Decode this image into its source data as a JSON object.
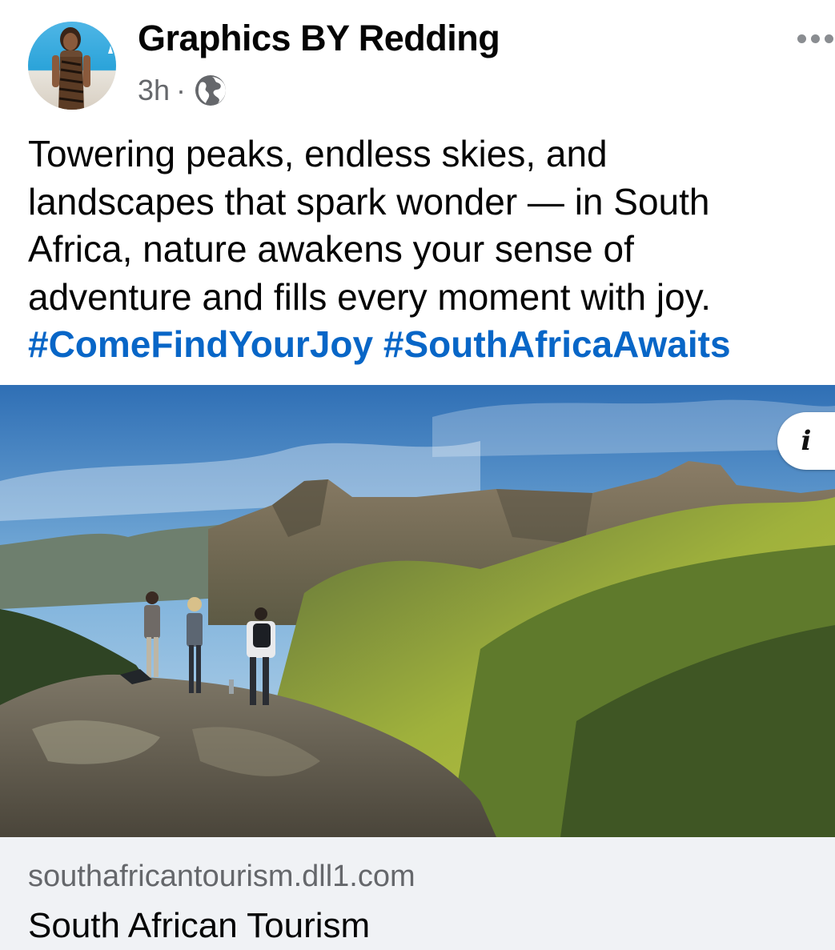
{
  "post": {
    "author": "Graphics BY Redding",
    "timestamp": "3h",
    "separator": "·",
    "audience_icon": "globe-icon",
    "text_lines": [
      "Towering peaks, endless skies, and",
      "landscapes that spark wonder — in South",
      "Africa, nature awakens your sense of",
      "adventure and fills every moment with joy."
    ],
    "hashtags": [
      "#ComeFindYourJoy",
      "#SouthAfricaAwaits"
    ]
  },
  "link_preview": {
    "info_glyph": "i",
    "domain": "southafricantourism.dll1.com",
    "title": "South African Tourism"
  },
  "colors": {
    "hashtag": "#0866c7",
    "meta_text": "#65676b",
    "footer_bg": "#f0f2f5"
  }
}
